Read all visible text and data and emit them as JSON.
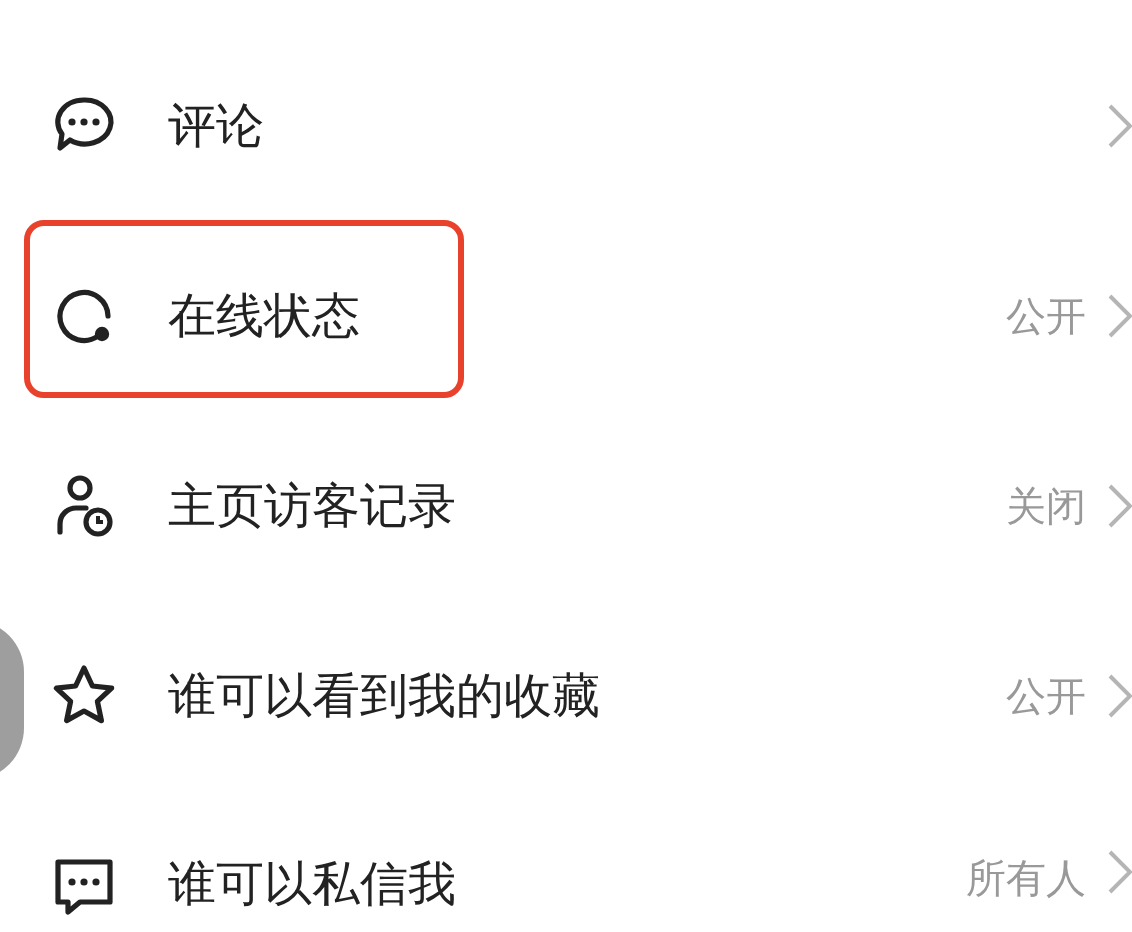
{
  "settings": [
    {
      "kind": "comment",
      "label": "评论",
      "highlighted": false
    },
    {
      "kind": "status",
      "label": "在线状态",
      "value": "公开",
      "highlighted": true
    },
    {
      "kind": "visitor",
      "label": "主页访客记录",
      "value": "关闭",
      "highlighted": false
    },
    {
      "kind": "star",
      "label": "谁可以看到我的收藏",
      "value": "公开",
      "highlighted": false
    },
    {
      "kind": "message",
      "label": "谁可以私信我",
      "value": "所有人",
      "highlighted": false
    }
  ]
}
